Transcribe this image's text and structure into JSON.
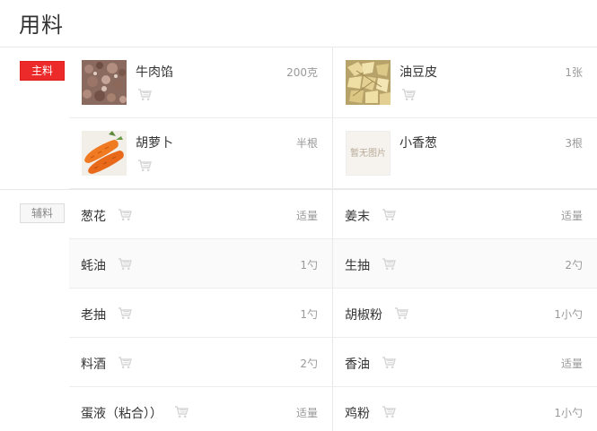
{
  "header": {
    "title": "用料"
  },
  "main_section": {
    "badge": "主料",
    "items": [
      {
        "name": "牛肉馅",
        "qty": "200克",
        "image": "ground-beef-photo"
      },
      {
        "name": "油豆皮",
        "qty": "1张",
        "image": "tofu-skin-photo"
      },
      {
        "name": "胡萝卜",
        "qty": "半根",
        "image": "carrot-photo"
      },
      {
        "name": "小香葱",
        "qty": "3根",
        "image": "no-image",
        "no_image_text": "暂无图片"
      }
    ]
  },
  "aux_section": {
    "badge": "辅料",
    "items": [
      {
        "name": "葱花",
        "qty": "适量"
      },
      {
        "name": "姜末",
        "qty": "适量"
      },
      {
        "name": "蚝油",
        "qty": "1勺"
      },
      {
        "name": "生抽",
        "qty": "2勺"
      },
      {
        "name": "老抽",
        "qty": "1勺"
      },
      {
        "name": "胡椒粉",
        "qty": "1小勺"
      },
      {
        "name": "料酒",
        "qty": "2勺"
      },
      {
        "name": "香油",
        "qty": "适量"
      },
      {
        "name": "蛋液（粘合））",
        "qty": "适量"
      },
      {
        "name": "鸡粉",
        "qty": "1小勺"
      }
    ]
  },
  "colors": {
    "accent_red": "#ec2a2a",
    "cart_icon": "#d6d6d6",
    "divider": "#e8e8e8"
  },
  "icons": {
    "cart": "shopping-cart-icon"
  }
}
